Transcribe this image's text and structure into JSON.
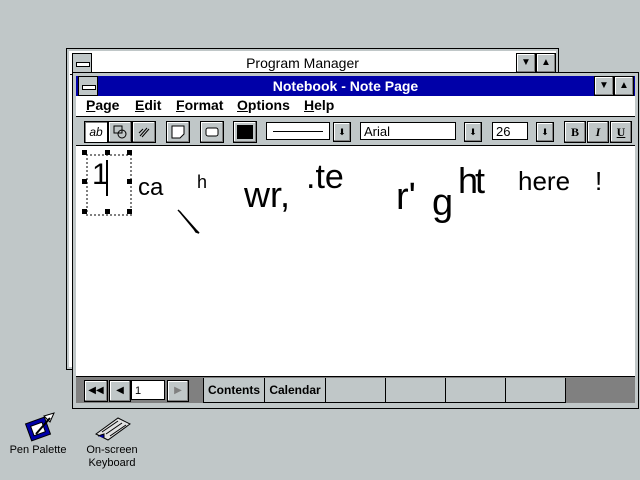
{
  "program_manager": {
    "title": "Program Manager",
    "minimize_glyph": "▼",
    "maximize_glyph": "▲"
  },
  "notebook": {
    "title": "Notebook - Note Page",
    "minimize_glyph": "▼",
    "maximize_glyph": "▲",
    "menu": [
      {
        "label": "Page",
        "u": "P",
        "rest": "age"
      },
      {
        "label": "Edit",
        "u": "E",
        "rest": "dit"
      },
      {
        "label": "Format",
        "u": "F",
        "rest": "ormat"
      },
      {
        "label": "Options",
        "u": "O",
        "rest": "ptions"
      },
      {
        "label": "Help",
        "u": "H",
        "rest": "elp"
      }
    ],
    "toolbar": {
      "font_name": "Arial",
      "font_size": "26",
      "bold_label": "B",
      "italic_label": "I",
      "underline_label": "U",
      "dropdown_glyph": "⬇"
    },
    "ink_text": [
      "1",
      "ca",
      "h",
      "wr,",
      ".te",
      "r'",
      "g",
      "ht",
      "here",
      "!"
    ],
    "bottom": {
      "first_glyph": "◀◀",
      "prev_glyph": "◀",
      "page_number": "1",
      "next_glyph": "▶",
      "tabs": [
        "Contents",
        "Calendar",
        "",
        "",
        "",
        ""
      ]
    }
  },
  "desktop_icons": [
    {
      "label": "Pen Palette",
      "icon": "pen-palette-icon"
    },
    {
      "label_line1": "On-screen",
      "label_line2": "Keyboard",
      "icon": "keyboard-icon"
    }
  ]
}
